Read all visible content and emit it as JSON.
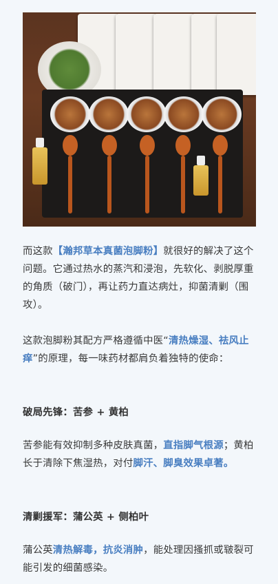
{
  "image": {
    "alt": "herbal-foot-soak-image"
  },
  "p1": {
    "pre": "而这款",
    "hl": "【瀚邦草本真菌泡脚粉】",
    "post": "就很好的解决了这个问题。它通过热水的蒸汽和浸泡，先软化、剥脱厚重的角质（破门），再让药力直达病灶，抑菌清剿（围攻）。"
  },
  "p2": {
    "pre": "这款泡脚粉其配方严格遵循中医",
    "q1": "“",
    "hl": "清热燥湿、祛风止痒",
    "q2": "”",
    "post": "的原理，每一味药材都肩负着独特的使命："
  },
  "h1": "破局先锋：苦参 + 黄柏",
  "p3": {
    "pre": "苦参能有效抑制多种皮肤真菌，",
    "hl1": "直指脚气根源",
    "mid": "；黄柏长于清除下焦湿热，对付",
    "hl2": "脚汗、脚臭效果卓著。"
  },
  "h2": "清剿援军：蒲公英 + 侧柏叶",
  "p4": {
    "pre": "蒲公英",
    "hl1": "清热解毒",
    "sep": "，",
    "hl2": "抗炎消肿",
    "post": "，能处理因搔抓或皲裂可能引发的细菌感染。"
  }
}
